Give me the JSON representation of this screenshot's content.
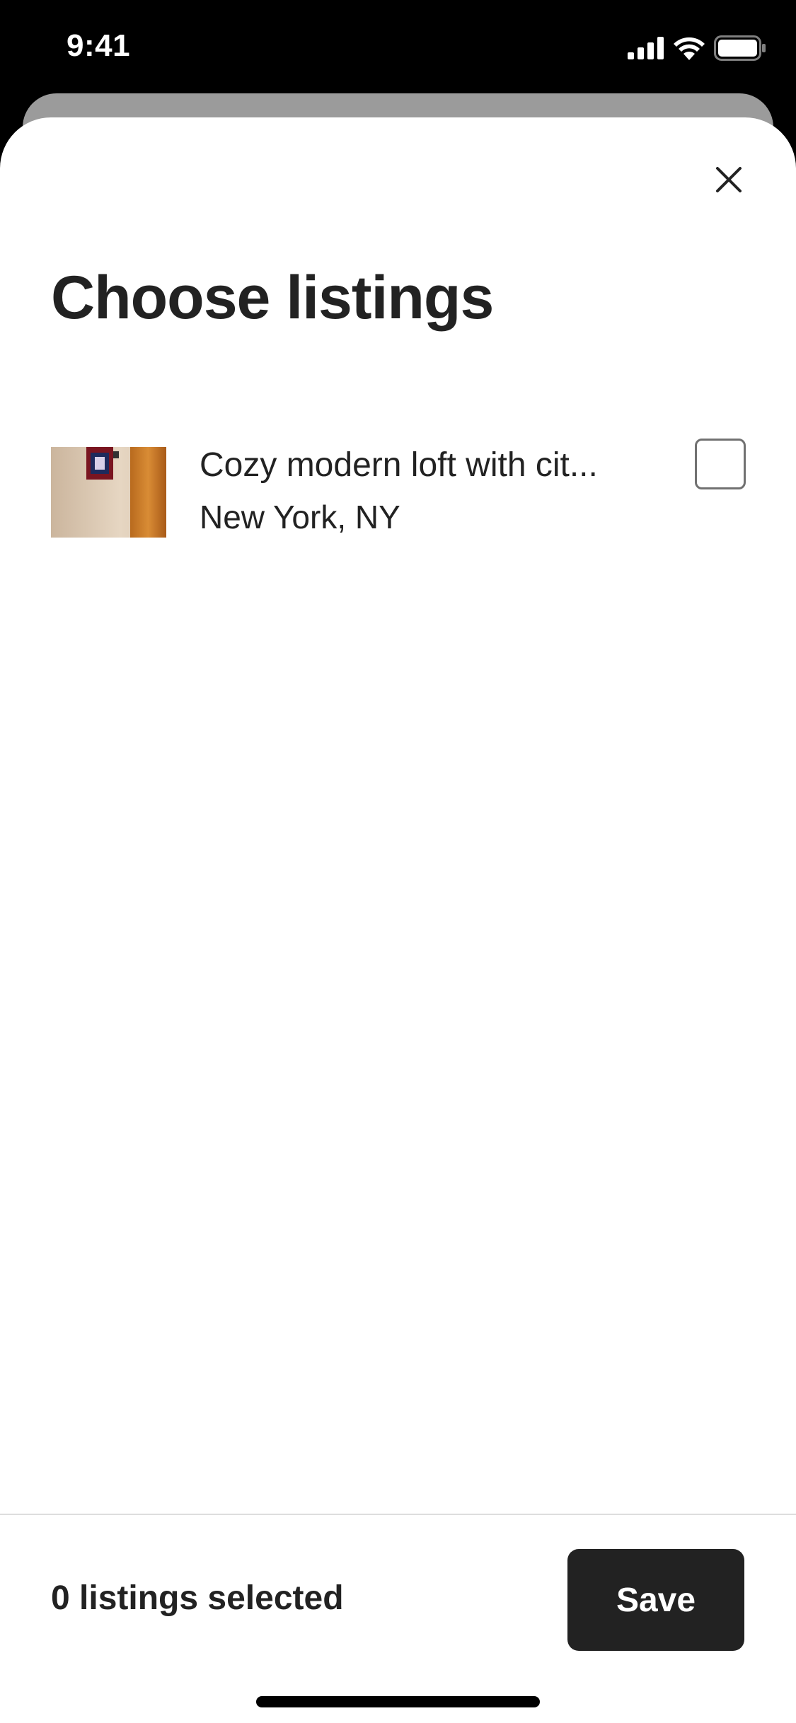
{
  "status_bar": {
    "time": "9:41",
    "icons": [
      "signal-icon",
      "wifi-icon",
      "battery-icon"
    ]
  },
  "modal": {
    "title": "Choose listings",
    "close_icon": "close-icon"
  },
  "listings": [
    {
      "title": "Cozy modern loft with cit...",
      "location": "New York, NY",
      "selected": false
    }
  ],
  "footer": {
    "selected_count_text": "0 listings selected",
    "save_label": "Save"
  },
  "colors": {
    "text": "#222222",
    "button_bg": "#222222",
    "checkbox_border": "#717171",
    "divider": "#dddddd"
  }
}
